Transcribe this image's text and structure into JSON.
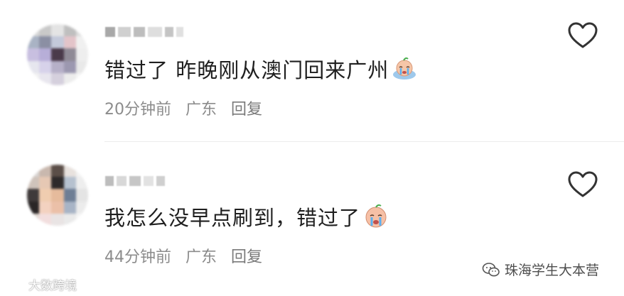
{
  "comments": [
    {
      "text": "错过了 昨晚刚从澳门回来广州",
      "time": "20分钟前",
      "location": "广东",
      "reply": "回复",
      "emoji": "crying-face-emoji"
    },
    {
      "text": "我怎么没早点刷到，错过了",
      "time": "44分钟前",
      "location": "广东",
      "reply": "回复",
      "emoji": "crying-face-emoji"
    }
  ],
  "watermarks": {
    "left": "大数跨境",
    "right": "珠海学生大本营"
  },
  "colors": {
    "text": "#1f1f1f",
    "meta": "#8c8c8c",
    "divider": "#ececec"
  }
}
